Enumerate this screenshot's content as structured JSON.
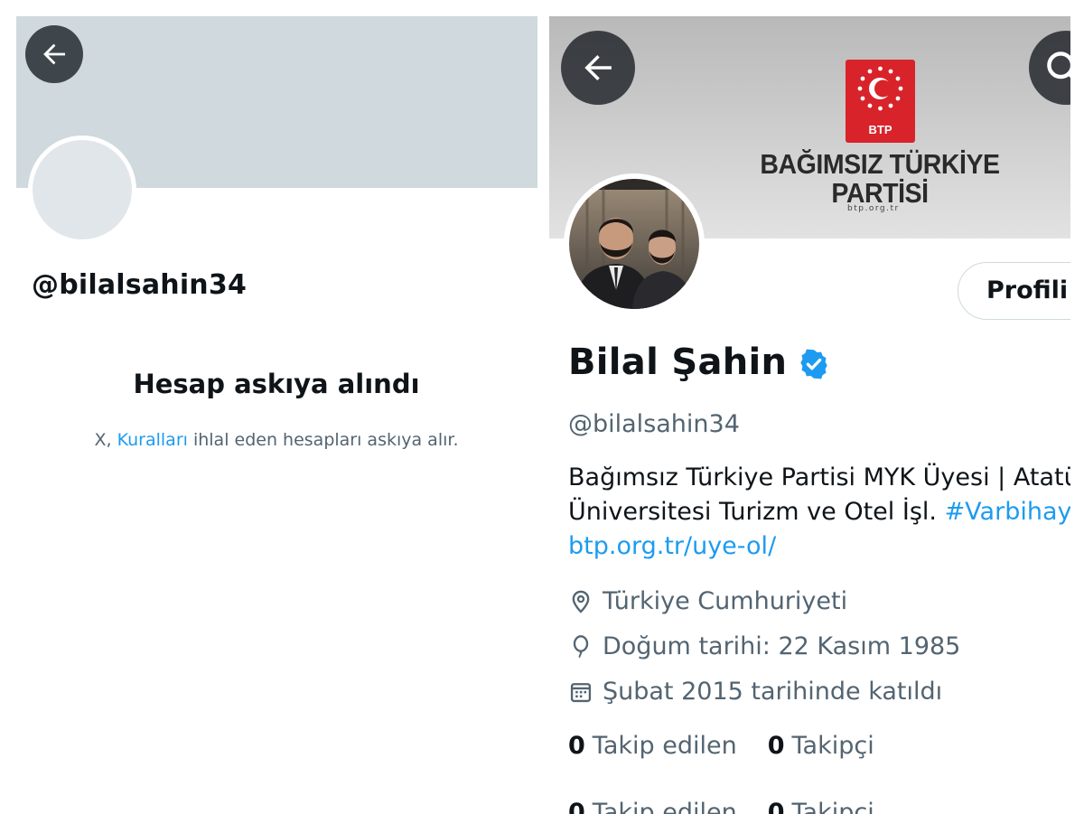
{
  "left": {
    "handle": "@bilalsahin34",
    "suspended_title": "Hesap askıya alındı",
    "suspended_text_prefix": "X, ",
    "suspended_link": "Kuralları",
    "suspended_text_suffix": " ihlal eden hesapları askıya alır."
  },
  "right": {
    "banner": {
      "logo_text": "BTP",
      "party_name_line1": "BAĞIMSIZ TÜRKİYE",
      "party_name_line2": "PARTİSİ",
      "party_url": "btp.org.tr"
    },
    "edit_profile_label": "Profili d",
    "display_name": "Bilal Şahin",
    "handle": "@bilalsahin34",
    "bio_line1": "Bağımsız Türkiye Partisi MYK Üyesi | Atatürk",
    "bio_line2_text": "Üniversitesi Turizm ve Otel İşl. ",
    "bio_hashtag": "#Varbihayali",
    "bio_link": "btp.org.tr/uye-ol/",
    "location": "Türkiye Cumhuriyeti",
    "birthday": "Doğum tarihi: 22 Kasım 1985",
    "joined": "Şubat 2015 tarihinde katıldı",
    "following_count": "0",
    "following_label": "Takip edilen",
    "followers_count": "0",
    "followers_label": "Takipçi"
  },
  "colors": {
    "accent": "#1d9bf0",
    "secondary_text": "#536471",
    "banner_placeholder": "#cfd9de",
    "btp_red": "#d8232a"
  },
  "icons": [
    "back-arrow-icon",
    "search-icon",
    "verified-badge-icon",
    "location-pin-icon",
    "balloon-icon",
    "calendar-icon",
    "btp-logo-icon"
  ]
}
